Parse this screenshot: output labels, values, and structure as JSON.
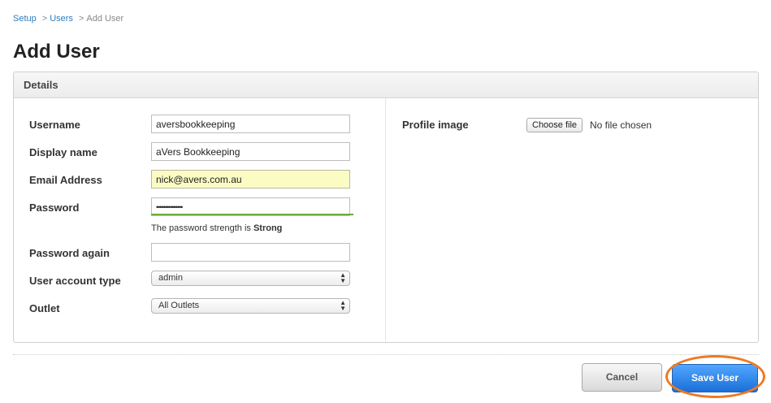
{
  "breadcrumb": {
    "items": [
      {
        "label": "Setup"
      },
      {
        "label": "Users"
      }
    ],
    "current": "Add User",
    "separator": ">"
  },
  "page": {
    "title": "Add User"
  },
  "panel": {
    "header": "Details"
  },
  "form": {
    "username": {
      "label": "Username",
      "value": "aversbookkeeping"
    },
    "display_name": {
      "label": "Display name",
      "value": "aVers Bookkeeping"
    },
    "email": {
      "label": "Email Address",
      "value": "nick@avers.com.au"
    },
    "password": {
      "label": "Password",
      "value": "•••••••••••••••"
    },
    "password_strength": {
      "prefix": "The password strength is",
      "value": "Strong"
    },
    "password_again": {
      "label": "Password again",
      "value": ""
    },
    "account_type": {
      "label": "User account type",
      "selected": "admin"
    },
    "outlet": {
      "label": "Outlet",
      "selected": "All Outlets"
    },
    "profile_image": {
      "label": "Profile image",
      "button": "Choose file",
      "status": "No file chosen"
    }
  },
  "actions": {
    "cancel": "Cancel",
    "save": "Save User"
  },
  "colors": {
    "link": "#2b7bc0",
    "primary_button": "#2a7ee6",
    "strength_bar": "#6cab3a",
    "autofill_bg": "#fafcc3",
    "highlight_ring": "#ee7a25"
  }
}
